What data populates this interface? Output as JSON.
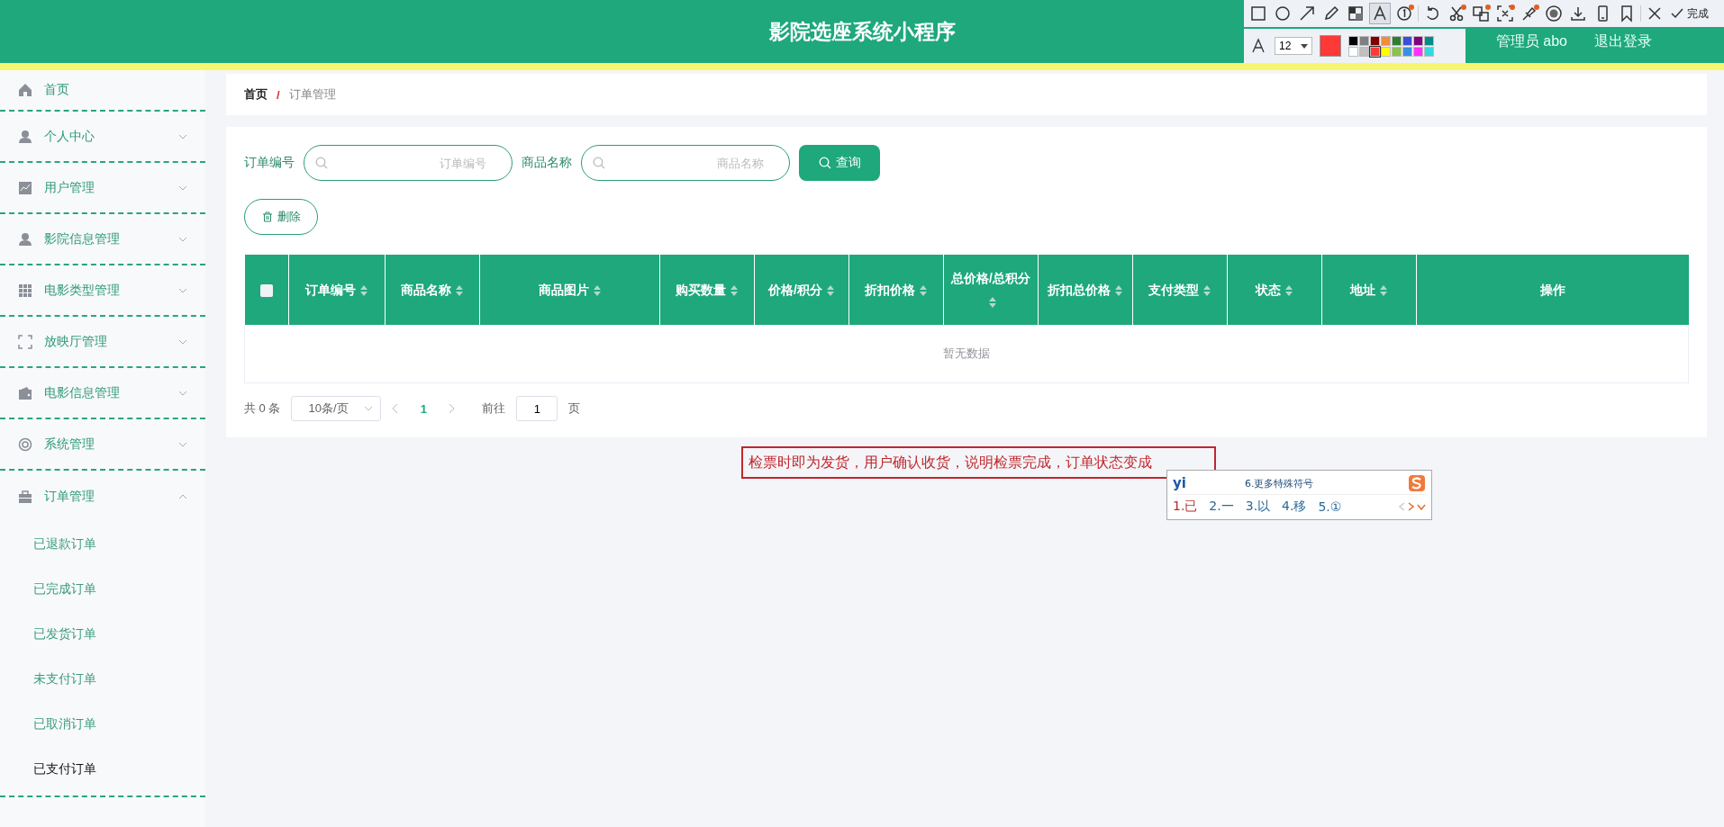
{
  "header": {
    "title": "影院选座系统小程序",
    "user": "管理员 abo",
    "logout": "退出登录"
  },
  "toolbar": {
    "tools": [
      {
        "kind": "rect",
        "selected": false,
        "badge": false
      },
      {
        "kind": "circle",
        "selected": false,
        "badge": false
      },
      {
        "kind": "arrow",
        "selected": false,
        "badge": false
      },
      {
        "kind": "pen",
        "selected": false,
        "badge": false
      },
      {
        "kind": "mosaic",
        "selected": false,
        "badge": false
      },
      {
        "kind": "text",
        "selected": true,
        "badge": false
      },
      {
        "kind": "number",
        "selected": false,
        "badge": true
      },
      {
        "kind": "undo",
        "selected": false,
        "badge": false
      },
      {
        "kind": "scissors",
        "selected": false,
        "badge": true
      },
      {
        "kind": "translate",
        "selected": false,
        "badge": true
      },
      {
        "kind": "crop",
        "selected": false,
        "badge": true
      },
      {
        "kind": "pin",
        "selected": false,
        "badge": true
      },
      {
        "kind": "record",
        "selected": false,
        "badge": false
      },
      {
        "kind": "download",
        "selected": false,
        "badge": false
      },
      {
        "kind": "phone",
        "selected": false,
        "badge": false
      },
      {
        "kind": "bookmark",
        "selected": false,
        "badge": false
      },
      {
        "kind": "close",
        "selected": false,
        "badge": false
      }
    ],
    "done": "完成",
    "font_size": "12",
    "palette": [
      {
        "color": "#000000",
        "selected": false
      },
      {
        "color": "#808080",
        "selected": false
      },
      {
        "color": "#800000",
        "selected": false
      },
      {
        "color": "#f08c3c",
        "selected": false
      },
      {
        "color": "#2e7d32",
        "selected": false
      },
      {
        "color": "#3b4fd8",
        "selected": false
      },
      {
        "color": "#800080",
        "selected": false
      },
      {
        "color": "#008b8b",
        "selected": false
      },
      {
        "color": "#ffffff",
        "selected": false
      },
      {
        "color": "#c0c0c0",
        "selected": false
      },
      {
        "color": "#ff3838",
        "selected": true
      },
      {
        "color": "#ffff00",
        "selected": false
      },
      {
        "color": "#8bc34a",
        "selected": false
      },
      {
        "color": "#3b8fe0",
        "selected": false
      },
      {
        "color": "#ff30ff",
        "selected": false
      },
      {
        "color": "#30d8e0",
        "selected": false
      }
    ]
  },
  "sidebar": {
    "items": [
      {
        "label": "首页",
        "kind": "home"
      },
      {
        "label": "个人中心",
        "kind": "user",
        "expanded": false
      },
      {
        "label": "用户管理",
        "kind": "chart",
        "expanded": false
      },
      {
        "label": "影院信息管理",
        "kind": "user",
        "expanded": false
      },
      {
        "label": "电影类型管理",
        "kind": "grid",
        "expanded": false
      },
      {
        "label": "放映厅管理",
        "kind": "frame",
        "expanded": false
      },
      {
        "label": "电影信息管理",
        "kind": "wallet",
        "expanded": false
      },
      {
        "label": "系统管理",
        "kind": "lifebuoy",
        "expanded": false
      },
      {
        "label": "订单管理",
        "kind": "briefcase",
        "expanded": true,
        "children": [
          {
            "label": "已退款订单",
            "selected": false
          },
          {
            "label": "已完成订单",
            "selected": false
          },
          {
            "label": "已发货订单",
            "selected": false
          },
          {
            "label": "未支付订单",
            "selected": false
          },
          {
            "label": "已取消订单",
            "selected": false
          },
          {
            "label": "已支付订单",
            "selected": true
          }
        ]
      }
    ]
  },
  "breadcrumb": [
    "首页",
    "订单管理"
  ],
  "breadcrumb_separator": "/",
  "filters": [
    {
      "label": "订单编号",
      "placeholder": "订单编号"
    },
    {
      "label": "商品名称",
      "placeholder": "商品名称"
    }
  ],
  "search_button": "查询",
  "delete_button": "删除",
  "table": {
    "select_all": {
      "checked": false
    },
    "columns": [
      {
        "label": "订单编号",
        "sortable": true
      },
      {
        "label": "商品名称",
        "sortable": true
      },
      {
        "label": "商品图片",
        "sortable": true
      },
      {
        "label": "购买数量",
        "sortable": true
      },
      {
        "label": "价格/积分",
        "sortable": true
      },
      {
        "label": "折扣价格",
        "sortable": true
      },
      {
        "label": "总价格/总积分",
        "sortable": true
      },
      {
        "label": "折扣总价格",
        "sortable": true
      },
      {
        "label": "支付类型",
        "sortable": true
      },
      {
        "label": "状态",
        "sortable": true
      },
      {
        "label": "地址",
        "sortable": true
      },
      {
        "label": "操作",
        "sortable": false
      }
    ],
    "empty_text": "暂无数据"
  },
  "pagination": {
    "total": "共 0 条",
    "page_size": "10条/页",
    "pages": [
      {
        "label": "1",
        "selected": true
      }
    ],
    "goto_label": "前往",
    "goto_value": "1",
    "page_unit": "页"
  },
  "annotation": {
    "text": "检票时即为发货，用户确认收货，说明检票完成，订单状态变成"
  },
  "ime": {
    "input": "yi",
    "more": "6.更多特殊符号",
    "candidates": [
      "1.已",
      "2.一",
      "3.以",
      "4.移",
      "5.①"
    ]
  }
}
